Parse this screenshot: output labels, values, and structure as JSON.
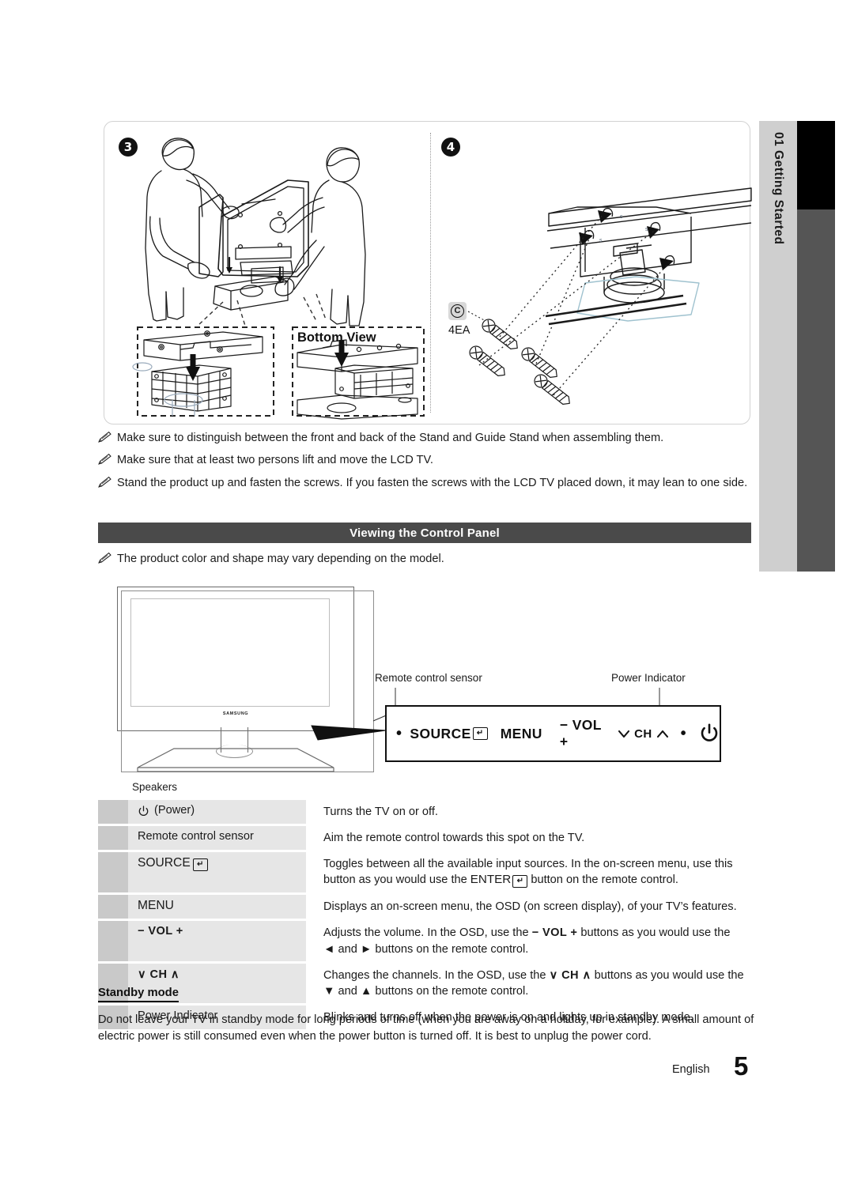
{
  "side_tab": {
    "chapter_number": "01",
    "chapter_title": "Getting Started",
    "label": "01  Getting Started"
  },
  "illustration": {
    "step3": {
      "badge": "3",
      "bottom_view_label": "Bottom View"
    },
    "step4": {
      "badge": "4",
      "part_letter": "C",
      "part_quantity": "4EA"
    }
  },
  "notes": [
    "Make sure to distinguish between the front and back of the Stand and Guide Stand when assembling them.",
    "Make sure that at least two persons lift and move the LCD TV.",
    "Stand the product up and fasten the screws.  If you fasten the screws with the LCD TV placed down, it may lean to one side."
  ],
  "section": {
    "title": "Viewing the Control Panel",
    "note": "The product color and shape may vary depending on the model."
  },
  "diagram": {
    "labels": {
      "speakers": "Speakers",
      "remote_control_sensor": "Remote control sensor",
      "power_indicator": "Power Indicator"
    },
    "tv_brand": "SAMSUNG",
    "control_panel_buttons": [
      "SOURCE",
      "MENU",
      "− VOL +",
      "CH",
      "POWER"
    ],
    "control_panel_text": "SOURCE   MENU   − VOL +   ∨ CH ∧"
  },
  "table": {
    "rows": [
      {
        "label": "(Power)",
        "label_prefix_icon": "power-icon",
        "desc": "Turns the TV on or off."
      },
      {
        "label": "Remote control sensor",
        "desc": "Aim the remote control towards this spot on the TV."
      },
      {
        "label": "SOURCE",
        "label_suffix_icon": "enter-icon",
        "desc_line1": "Toggles between all the available input sources. In the on-screen menu, use this",
        "desc_line2_pre": "button as you would use the ",
        "desc_line2_key": "ENTER",
        "desc_line2_post": " button on the remote control."
      },
      {
        "label": "MENU",
        "desc": "Displays an on-screen menu, the OSD (on screen display), of your TV’s features."
      },
      {
        "label": "− VOL +",
        "desc_line1_pre": "Adjusts the volume. In the OSD, use the ",
        "desc_line1_key": "− VOL +",
        "desc_line1_post": " buttons as you would use the",
        "desc_line2": "◄ and ► buttons on the remote control."
      },
      {
        "label": "∨ CH ∧",
        "desc_line1_pre": "Changes the channels. In the OSD, use the ",
        "desc_line1_key": "∨ CH ∧",
        "desc_line1_post": " buttons as you would use the",
        "desc_line2": "▼ and ▲ buttons on the remote control."
      },
      {
        "label": "Power Indicator",
        "desc": "Blinks and turns off when the power is on and lights up in standby mode."
      }
    ]
  },
  "standby": {
    "heading": "Standby mode",
    "body": "Do not leave your TV in standby mode for long periods of time (when you are away on a holiday, for example). A small amount of electric power is still consumed even when the power button is turned off. It is best to unplug the power cord."
  },
  "footer": {
    "language": "English",
    "page_number": "5"
  },
  "colors": {
    "section_bar": "#4a4a4a",
    "table_gutter": "#c9c9c9",
    "table_label": "#e6e6e6",
    "side_tab_light": "#cfcfcf",
    "side_tab_dark": "#555555"
  }
}
